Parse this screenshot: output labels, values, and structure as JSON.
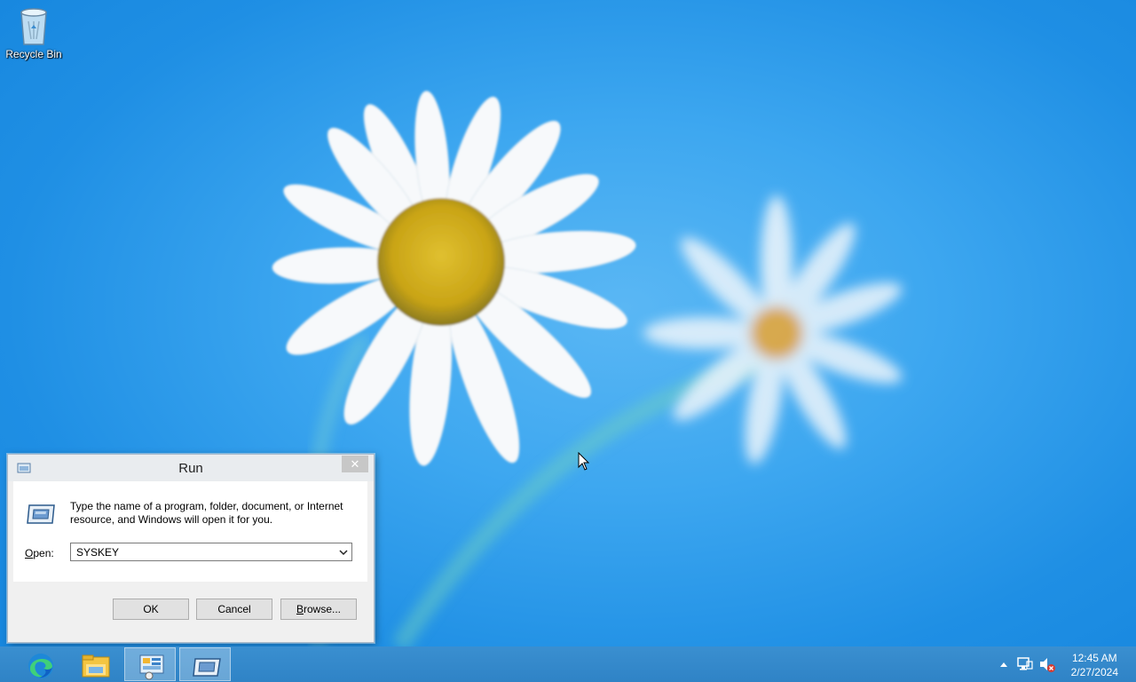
{
  "desktop": {
    "icons": [
      {
        "label": "Recycle Bin",
        "icon": "recycle-bin-icon"
      }
    ]
  },
  "run_dialog": {
    "title": "Run",
    "close_label": "✕",
    "description": "Type the name of a program, folder, document, or Internet resource, and Windows will open it for you.",
    "open_label_prefix": "",
    "open_label_access": "O",
    "open_label_rest": "pen:",
    "open_value": "SYSKEY",
    "buttons": {
      "ok": "OK",
      "cancel": "Cancel",
      "browse": "Browse..."
    }
  },
  "taskbar": {
    "apps": [
      {
        "name": "Microsoft Edge",
        "icon": "edge-icon",
        "active": false
      },
      {
        "name": "File Explorer",
        "icon": "file-explorer-icon",
        "active": false
      },
      {
        "name": "Server Manager",
        "icon": "server-manager-icon",
        "active": true
      },
      {
        "name": "Run",
        "icon": "run-icon",
        "active": true
      }
    ],
    "tray": {
      "icons": [
        "show-hidden-icons-icon",
        "network-icon",
        "volume-muted-icon"
      ]
    },
    "clock": {
      "time": "12:45 AM",
      "date": "2/27/2024"
    }
  },
  "colors": {
    "desktop_blue": "#2f96e8",
    "taskbar": "#2f83c6",
    "dialog_bg": "#f0f0f0"
  }
}
